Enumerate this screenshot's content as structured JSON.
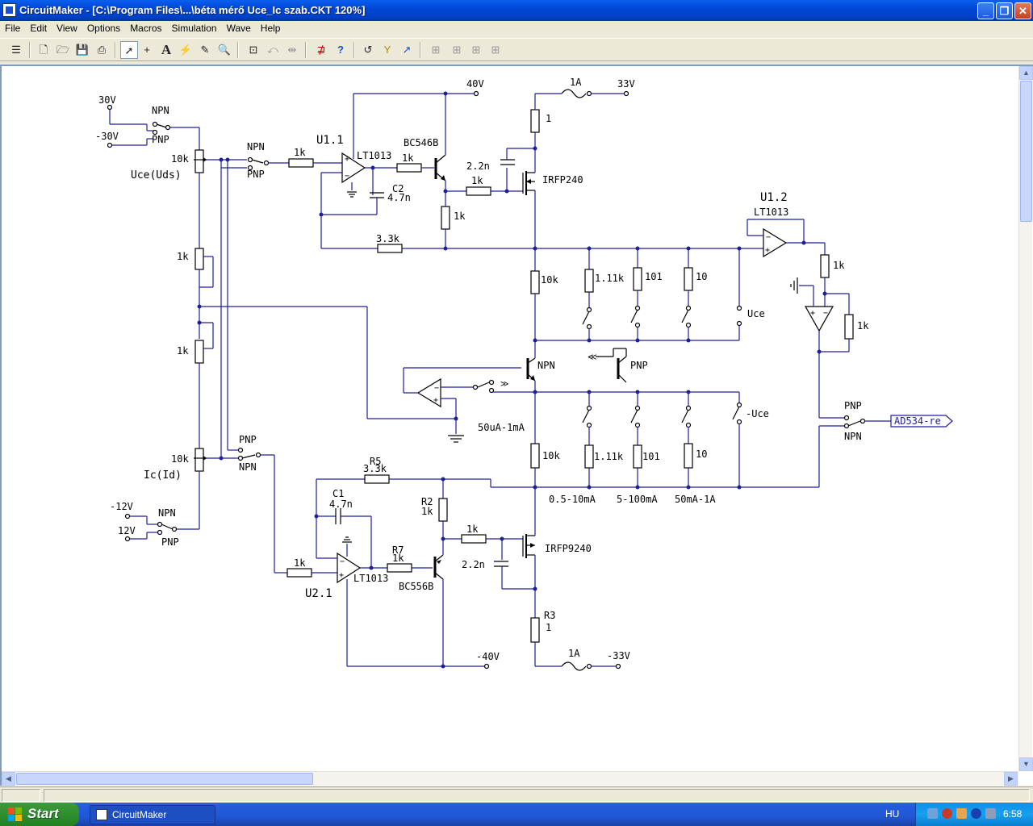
{
  "window": {
    "title": "CircuitMaker - [C:\\Program Files\\...\\béta mérő Uce_Ic szab.CKT 120%]"
  },
  "menu": [
    "File",
    "Edit",
    "View",
    "Options",
    "Macros",
    "Simulation",
    "Wave",
    "Help"
  ],
  "toolbar_icons": [
    "component-icon",
    "new-icon",
    "open-icon",
    "save-icon",
    "print-icon",
    "arrow-tool-icon",
    "wire-tool-icon",
    "text-tool-icon",
    "probe-tool-icon",
    "ruler-tool-icon",
    "zoom-tool-icon",
    "zoom-page-icon",
    "rotate-icon",
    "mirror-icon",
    "digital-sim-icon",
    "help-icon",
    "reset-icon",
    "step-icon",
    "run-icon",
    "trace-icon",
    "scope1-icon",
    "scope2-icon",
    "scope3-icon"
  ],
  "schematic": {
    "supplies": {
      "v30": "30V",
      "vm30": "-30V",
      "v40": "40V",
      "v33": "33V",
      "vm12": "-12V",
      "v12": "12V",
      "vm40": "-40V",
      "vm33": "-33V"
    },
    "fuse_top": "1A",
    "fuse_bottom": "1A",
    "npn_label": "NPN",
    "pnp_label": "PNP",
    "pot_10k": "10k",
    "pot_1k": "1k",
    "uce_uds": "Uce(Uds)",
    "ic_id": "Ic(Id)",
    "r_1k": "1k",
    "u11": "U1.1",
    "u12": "U1.2",
    "u21": "U2.1",
    "lt1013": "LT1013",
    "bc546b": "BC546B",
    "bc556b": "BC556B",
    "irfp240": "IRFP240",
    "irfp9240": "IRFP9240",
    "c2_name": "C2",
    "c2_val": "4.7n",
    "c1_name": "C1",
    "c1_val": "4.7n",
    "cap_22n": "2.2n",
    "r_33k": "3.3k",
    "r5_name": "R5",
    "r2_name": "R2",
    "r7_name": "R7",
    "r3_name": "R3",
    "r_1": "1",
    "r_10k": "10k",
    "r_111k": "1.11k",
    "r_101": "101",
    "r_10": "10",
    "uce": "Uce",
    "muce": "-Uce",
    "range_50u": "50uA-1mA",
    "range_05": "0.5-10mA",
    "range_5": "5-100mA",
    "range_50m": "50mA-1A",
    "ad534": "AD534-re"
  },
  "taskbar": {
    "start": "Start",
    "app": "CircuitMaker",
    "lang": "HU",
    "clock": "6:58"
  }
}
